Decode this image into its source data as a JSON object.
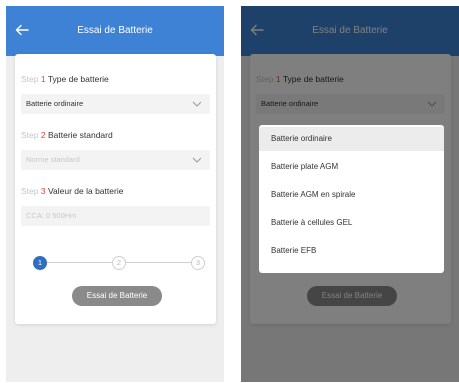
{
  "app": {
    "title": "Essai de Batterie"
  },
  "form": {
    "step_word": "Step",
    "steps": [
      {
        "num": "1",
        "title": "Type de batterie",
        "value": "Batterie ordinaire"
      },
      {
        "num": "2",
        "title": "Batterie standard",
        "placeholder": "Norme standard"
      },
      {
        "num": "3",
        "title": "Valeur de la batterie",
        "placeholder": "CCA: 0 500Hm"
      }
    ],
    "progress": {
      "labels": [
        "1",
        "2",
        "3"
      ],
      "current": 1
    },
    "submit_label": "Essai de Batterie"
  },
  "battery_type_menu": {
    "options": [
      "Batterie ordinaire",
      "Batterie plate AGM",
      "Batterie AGM en spirale",
      "Batterie à cellules GEL",
      "Batterie EFB"
    ],
    "selected": "Batterie ordinaire"
  },
  "colors": {
    "appbar": "#3d82d4",
    "step_number": "#e0463a",
    "active_dot": "#2f6fc0",
    "button": "#8a8a8a"
  }
}
